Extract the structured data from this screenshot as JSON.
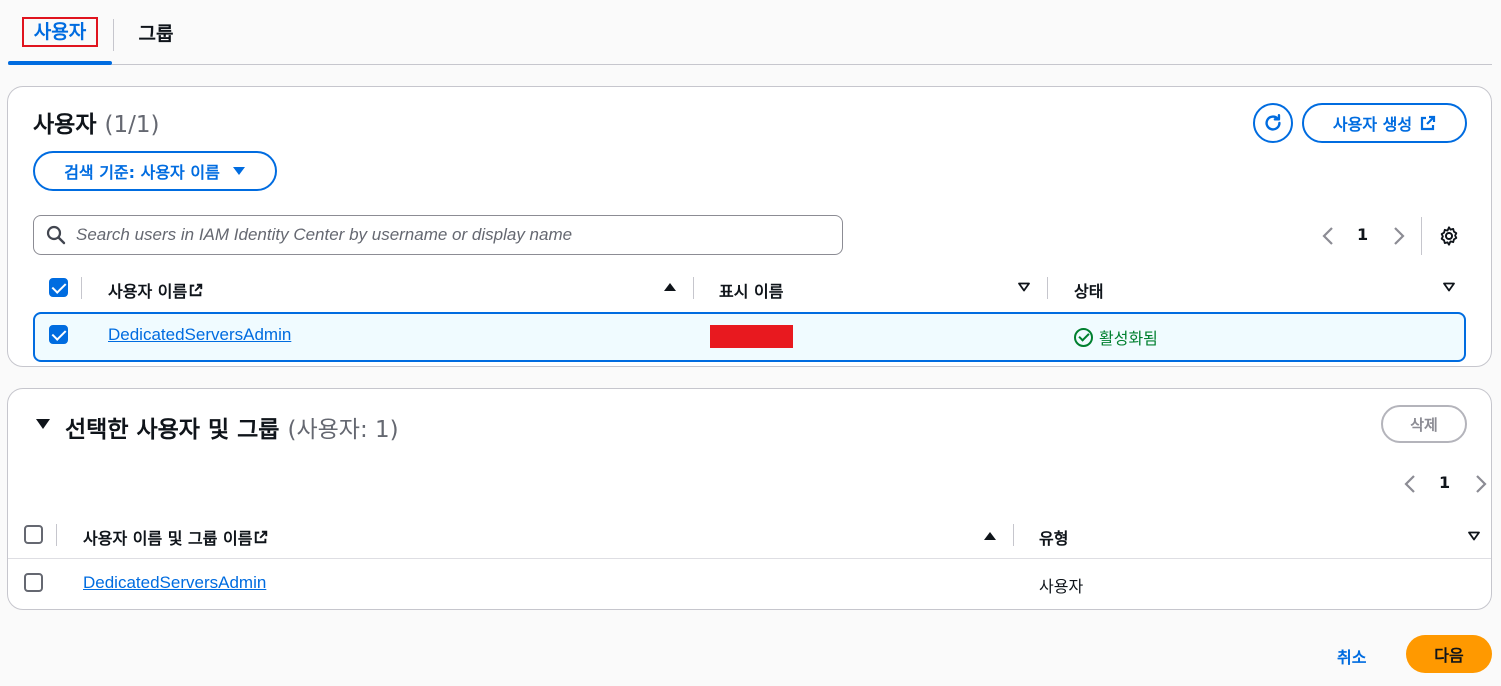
{
  "tabs": [
    {
      "label": "사용자",
      "active": true
    },
    {
      "label": "그룹",
      "active": false
    }
  ],
  "users_panel": {
    "title": "사용자",
    "count": "(1/1)",
    "create_button": "사용자 생성",
    "search_by_button": "검색 기준: 사용자 이름",
    "search_placeholder": "Search users in IAM Identity Center by username or display name",
    "page": "1",
    "columns": {
      "username": "사용자 이름",
      "display_name": "표시 이름",
      "status": "상태"
    },
    "rows": [
      {
        "username": "DedicatedServersAdmin",
        "display_name": "",
        "status": "활성화됨",
        "selected": true
      }
    ]
  },
  "selected_panel": {
    "title": "선택한 사용자 및 그룹",
    "count": "(사용자: 1)",
    "delete_button": "삭제",
    "page": "1",
    "columns": {
      "name": "사용자 이름 및 그룹 이름",
      "type": "유형"
    },
    "rows": [
      {
        "name": "DedicatedServersAdmin",
        "type": "사용자"
      }
    ]
  },
  "footer": {
    "cancel": "취소",
    "next": "다음"
  },
  "colors": {
    "accent": "#006ce0",
    "primary_button": "#ff9900",
    "success": "#00802f",
    "redaction": "#e8191f",
    "highlight_box": "#e0141e"
  },
  "icons": [
    "refresh-icon",
    "external-link-icon",
    "caret-down-icon",
    "search-icon",
    "chevron-left-icon",
    "chevron-right-icon",
    "settings-icon",
    "sort-ascending-icon",
    "sort-icon",
    "status-success-icon",
    "collapse-caret-icon"
  ]
}
